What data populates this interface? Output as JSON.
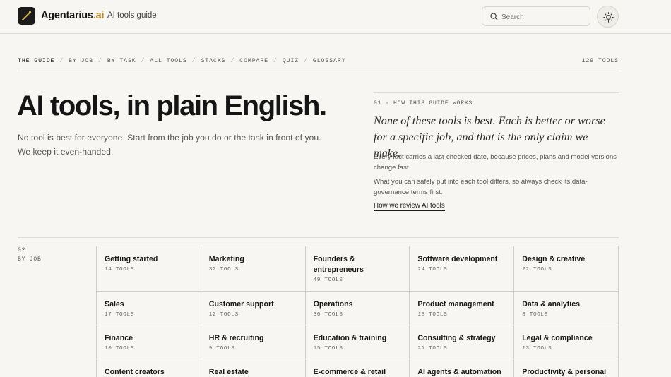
{
  "header": {
    "brand_main": "Agentarius",
    "brand_suffix": ".ai",
    "subtitle": "AI tools guide",
    "search_placeholder": "Search",
    "icons": {
      "logo": "wand-icon",
      "search": "search-icon",
      "theme": "sun-icon"
    },
    "accent_color": "#b8862a"
  },
  "nav": {
    "items": [
      "THE GUIDE",
      "BY JOB",
      "BY TASK",
      "ALL TOOLS",
      "STACKS",
      "COMPARE",
      "QUIZ",
      "GLOSSARY"
    ],
    "separator": "/",
    "active_index": 0,
    "tool_count": "129 TOOLS"
  },
  "hero": {
    "title": "AI tools, in plain English.",
    "subtitle": "No tool is best for everyone. Start from the job you do or the task in front of you. We keep it even-handed."
  },
  "aside": {
    "label": "01 · HOW THIS GUIDE WORKS",
    "quote": "None of these tools is best. Each is better or worse for a specific job, and that is the only claim we make.",
    "p1": "Every fact carries a last-checked date, because prices, plans and model versions change fast.",
    "p2": "What you can safely put into each tool differs, so always check its data-governance terms first.",
    "link": "How we review AI tools"
  },
  "by_job": {
    "number": "02",
    "label": "BY JOB",
    "rows": [
      [
        {
          "title": "Getting started",
          "count": "14 TOOLS"
        },
        {
          "title": "Marketing",
          "count": "32 TOOLS"
        },
        {
          "title": "Founders & entrepreneurs",
          "count": "49 TOOLS"
        },
        {
          "title": "Software development",
          "count": "24 TOOLS"
        },
        {
          "title": "Design & creative",
          "count": "22 TOOLS"
        }
      ],
      [
        {
          "title": "Sales",
          "count": "17 TOOLS"
        },
        {
          "title": "Customer support",
          "count": "12 TOOLS"
        },
        {
          "title": "Operations",
          "count": "30 TOOLS"
        },
        {
          "title": "Product management",
          "count": "18 TOOLS"
        },
        {
          "title": "Data & analytics",
          "count": "8 TOOLS"
        }
      ],
      [
        {
          "title": "Finance",
          "count": "10 TOOLS"
        },
        {
          "title": "HR & recruiting",
          "count": "9 TOOLS"
        },
        {
          "title": "Education & training",
          "count": "15 TOOLS"
        },
        {
          "title": "Consulting & strategy",
          "count": "21 TOOLS"
        },
        {
          "title": "Legal & compliance",
          "count": "13 TOOLS"
        }
      ],
      [
        {
          "title": "Content creators",
          "count": ""
        },
        {
          "title": "Real estate",
          "count": ""
        },
        {
          "title": "E-commerce & retail",
          "count": ""
        },
        {
          "title": "AI agents & automation",
          "count": ""
        },
        {
          "title": "Productivity & personal",
          "count": ""
        }
      ]
    ]
  }
}
